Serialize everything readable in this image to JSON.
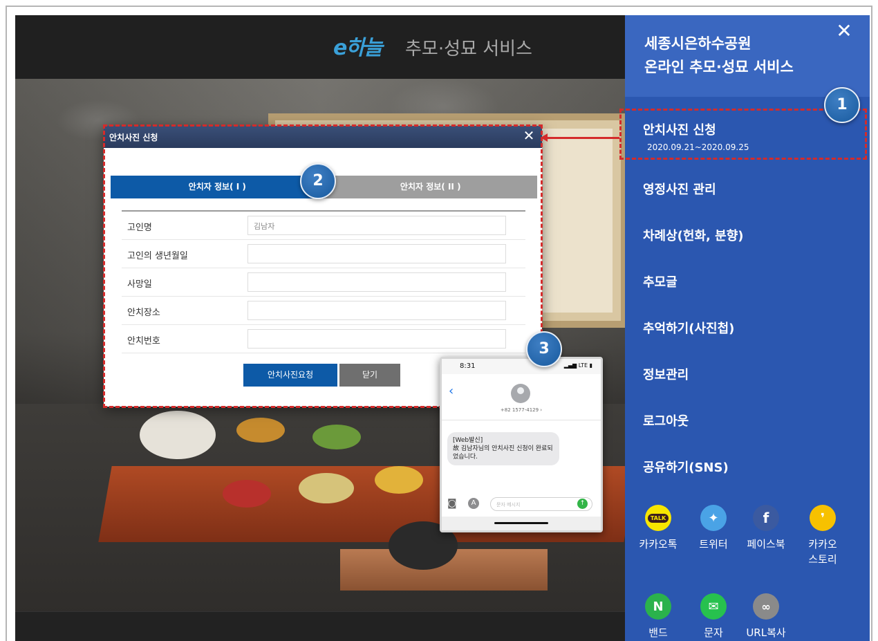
{
  "header": {
    "logo_text": "e하늘",
    "title": "추모·성묘 서비스"
  },
  "dialog": {
    "title": "안치사진 신청",
    "close_icon": "close-icon",
    "tabs": [
      "안치자 정보( I )",
      "안치자 정보( II )"
    ],
    "fields": [
      {
        "label": "고인명",
        "placeholder": "김남자"
      },
      {
        "label": "고인의 생년월일",
        "placeholder": ""
      },
      {
        "label": "사망일",
        "placeholder": ""
      },
      {
        "label": "안치장소",
        "placeholder": ""
      },
      {
        "label": "안치번호",
        "placeholder": ""
      }
    ],
    "request_button": "안치사진요청",
    "close_button": "닫기"
  },
  "badges": [
    "1",
    "2",
    "3"
  ],
  "phone": {
    "time": "8:31",
    "signal": "LTE",
    "number": "+82 1577-4129 ›",
    "message_line1": "[Web발신]",
    "message_line2": "故 김남자님의 안치사진 신청이 완료되었습니다.",
    "compose_placeholder": "문자 메시지"
  },
  "sidebar": {
    "title_line1": "세종시은하수공원",
    "title_line2": "온라인 추모·성묘 서비스",
    "menu": [
      {
        "label": "안치사진 신청",
        "sub": "2020.09.21~2020.09.25"
      },
      {
        "label": "영정사진 관리"
      },
      {
        "label": "차례상(헌화, 분향)"
      },
      {
        "label": "추모글"
      },
      {
        "label": "추억하기(사진첩)"
      },
      {
        "label": "정보관리"
      },
      {
        "label": "로그아웃"
      },
      {
        "label": "공유하기(SNS)"
      }
    ],
    "sns": [
      {
        "label": "카카오톡",
        "icon": "kakaotalk-icon",
        "color": "#f7e600"
      },
      {
        "label": "트위터",
        "icon": "twitter-icon",
        "color": "#4aa3e6"
      },
      {
        "label": "페이스북",
        "icon": "facebook-icon",
        "color": "#3b5aa0"
      },
      {
        "label": "카카오\n스토리",
        "icon": "kakaostory-icon",
        "color": "#f7c100"
      },
      {
        "label": "밴드",
        "icon": "band-icon",
        "color": "#2bb24c"
      },
      {
        "label": "문자",
        "icon": "message-icon",
        "color": "#27c14e"
      },
      {
        "label": "URL복사",
        "icon": "link-icon",
        "color": "#8a8a8a"
      }
    ]
  },
  "colors": {
    "sidebar_bg": "#2b57b0",
    "primary_button": "#0d5aa7",
    "annotation_red": "#d42b2b"
  }
}
